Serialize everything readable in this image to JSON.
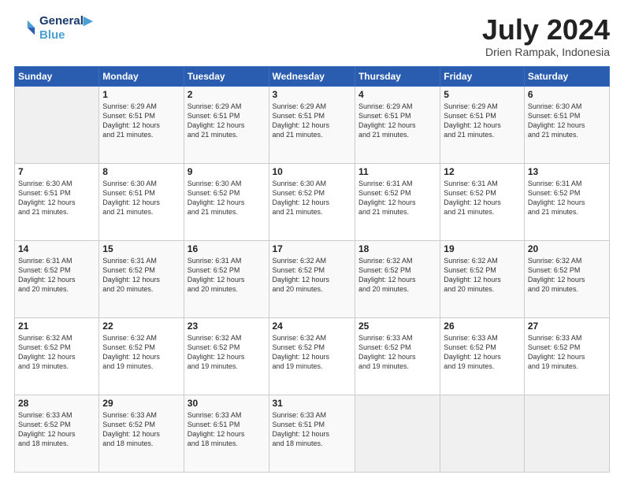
{
  "header": {
    "logo_line1": "General",
    "logo_line2": "Blue",
    "month_title": "July 2024",
    "location": "Drien Rampak, Indonesia"
  },
  "days_of_week": [
    "Sunday",
    "Monday",
    "Tuesday",
    "Wednesday",
    "Thursday",
    "Friday",
    "Saturday"
  ],
  "weeks": [
    [
      {
        "day": "",
        "info": ""
      },
      {
        "day": "1",
        "info": "Sunrise: 6:29 AM\nSunset: 6:51 PM\nDaylight: 12 hours\nand 21 minutes."
      },
      {
        "day": "2",
        "info": "Sunrise: 6:29 AM\nSunset: 6:51 PM\nDaylight: 12 hours\nand 21 minutes."
      },
      {
        "day": "3",
        "info": "Sunrise: 6:29 AM\nSunset: 6:51 PM\nDaylight: 12 hours\nand 21 minutes."
      },
      {
        "day": "4",
        "info": "Sunrise: 6:29 AM\nSunset: 6:51 PM\nDaylight: 12 hours\nand 21 minutes."
      },
      {
        "day": "5",
        "info": "Sunrise: 6:29 AM\nSunset: 6:51 PM\nDaylight: 12 hours\nand 21 minutes."
      },
      {
        "day": "6",
        "info": "Sunrise: 6:30 AM\nSunset: 6:51 PM\nDaylight: 12 hours\nand 21 minutes."
      }
    ],
    [
      {
        "day": "7",
        "info": "Sunrise: 6:30 AM\nSunset: 6:51 PM\nDaylight: 12 hours\nand 21 minutes."
      },
      {
        "day": "8",
        "info": "Sunrise: 6:30 AM\nSunset: 6:51 PM\nDaylight: 12 hours\nand 21 minutes."
      },
      {
        "day": "9",
        "info": "Sunrise: 6:30 AM\nSunset: 6:52 PM\nDaylight: 12 hours\nand 21 minutes."
      },
      {
        "day": "10",
        "info": "Sunrise: 6:30 AM\nSunset: 6:52 PM\nDaylight: 12 hours\nand 21 minutes."
      },
      {
        "day": "11",
        "info": "Sunrise: 6:31 AM\nSunset: 6:52 PM\nDaylight: 12 hours\nand 21 minutes."
      },
      {
        "day": "12",
        "info": "Sunrise: 6:31 AM\nSunset: 6:52 PM\nDaylight: 12 hours\nand 21 minutes."
      },
      {
        "day": "13",
        "info": "Sunrise: 6:31 AM\nSunset: 6:52 PM\nDaylight: 12 hours\nand 21 minutes."
      }
    ],
    [
      {
        "day": "14",
        "info": "Sunrise: 6:31 AM\nSunset: 6:52 PM\nDaylight: 12 hours\nand 20 minutes."
      },
      {
        "day": "15",
        "info": "Sunrise: 6:31 AM\nSunset: 6:52 PM\nDaylight: 12 hours\nand 20 minutes."
      },
      {
        "day": "16",
        "info": "Sunrise: 6:31 AM\nSunset: 6:52 PM\nDaylight: 12 hours\nand 20 minutes."
      },
      {
        "day": "17",
        "info": "Sunrise: 6:32 AM\nSunset: 6:52 PM\nDaylight: 12 hours\nand 20 minutes."
      },
      {
        "day": "18",
        "info": "Sunrise: 6:32 AM\nSunset: 6:52 PM\nDaylight: 12 hours\nand 20 minutes."
      },
      {
        "day": "19",
        "info": "Sunrise: 6:32 AM\nSunset: 6:52 PM\nDaylight: 12 hours\nand 20 minutes."
      },
      {
        "day": "20",
        "info": "Sunrise: 6:32 AM\nSunset: 6:52 PM\nDaylight: 12 hours\nand 20 minutes."
      }
    ],
    [
      {
        "day": "21",
        "info": "Sunrise: 6:32 AM\nSunset: 6:52 PM\nDaylight: 12 hours\nand 19 minutes."
      },
      {
        "day": "22",
        "info": "Sunrise: 6:32 AM\nSunset: 6:52 PM\nDaylight: 12 hours\nand 19 minutes."
      },
      {
        "day": "23",
        "info": "Sunrise: 6:32 AM\nSunset: 6:52 PM\nDaylight: 12 hours\nand 19 minutes."
      },
      {
        "day": "24",
        "info": "Sunrise: 6:32 AM\nSunset: 6:52 PM\nDaylight: 12 hours\nand 19 minutes."
      },
      {
        "day": "25",
        "info": "Sunrise: 6:33 AM\nSunset: 6:52 PM\nDaylight: 12 hours\nand 19 minutes."
      },
      {
        "day": "26",
        "info": "Sunrise: 6:33 AM\nSunset: 6:52 PM\nDaylight: 12 hours\nand 19 minutes."
      },
      {
        "day": "27",
        "info": "Sunrise: 6:33 AM\nSunset: 6:52 PM\nDaylight: 12 hours\nand 19 minutes."
      }
    ],
    [
      {
        "day": "28",
        "info": "Sunrise: 6:33 AM\nSunset: 6:52 PM\nDaylight: 12 hours\nand 18 minutes."
      },
      {
        "day": "29",
        "info": "Sunrise: 6:33 AM\nSunset: 6:52 PM\nDaylight: 12 hours\nand 18 minutes."
      },
      {
        "day": "30",
        "info": "Sunrise: 6:33 AM\nSunset: 6:51 PM\nDaylight: 12 hours\nand 18 minutes."
      },
      {
        "day": "31",
        "info": "Sunrise: 6:33 AM\nSunset: 6:51 PM\nDaylight: 12 hours\nand 18 minutes."
      },
      {
        "day": "",
        "info": ""
      },
      {
        "day": "",
        "info": ""
      },
      {
        "day": "",
        "info": ""
      }
    ]
  ]
}
